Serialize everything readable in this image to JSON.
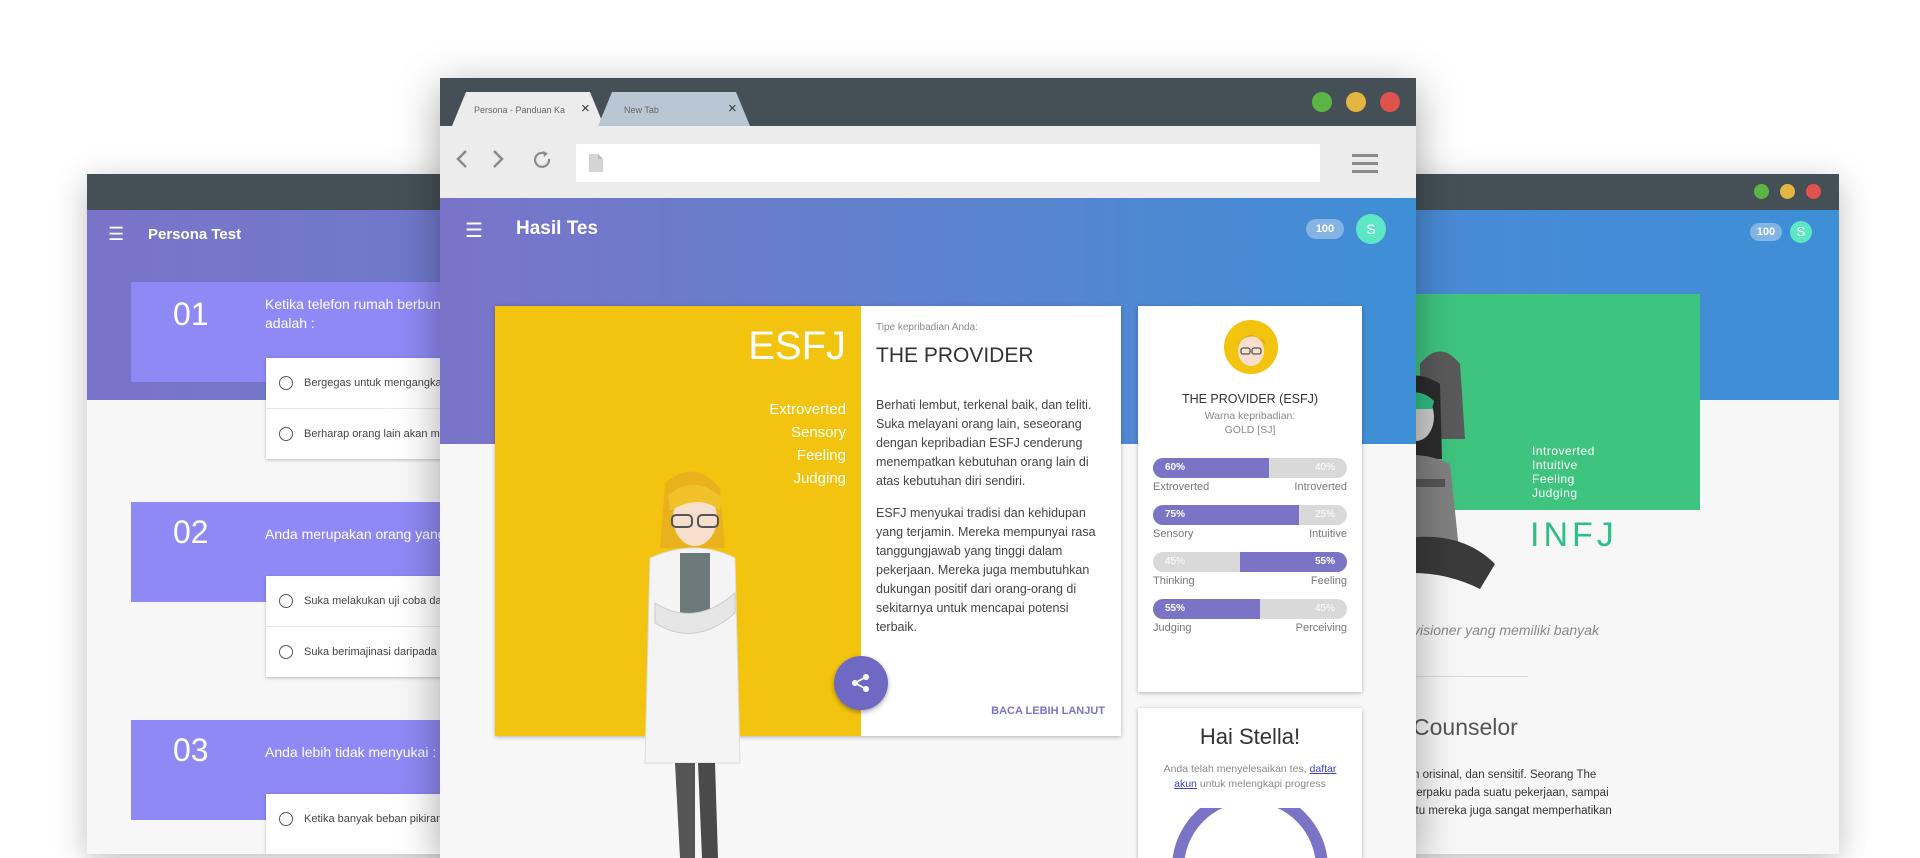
{
  "left_window": {
    "app_title": "Persona Test",
    "questions": [
      {
        "number": "01",
        "text": "Ketika telefon rumah berbunyi",
        "text_line2": "adalah :",
        "options": [
          "Bergegas untuk mengangkat",
          "Berharap orang lain akan men"
        ]
      },
      {
        "number": "02",
        "text": "Anda merupakan orang yang",
        "text_line2": "",
        "options": [
          "Suka melakukan uji coba dari",
          "Suka berimajinasi daripada m"
        ]
      },
      {
        "number": "03",
        "text": "Anda lebih tidak menyukai :",
        "text_line2": "",
        "options": [
          "Ketika banyak beban pikiran"
        ]
      }
    ]
  },
  "right_window": {
    "badge": "100",
    "avatar_initial": "S",
    "traits": [
      "Introverted",
      "Intuitive",
      "Feeling",
      "Judging"
    ],
    "type_code": "INFJ",
    "desc_italic": "visioner yang memiliki banyak",
    "subtitle": "Counselor",
    "body_lines": [
      "n orisinal, dan sensitif. Seorang The",
      "terpaku pada suatu pekerjaan, sampai",
      "itu mereka juga sangat memperhatikan"
    ]
  },
  "browser": {
    "tabs": [
      {
        "label": "Persona - Panduan Ka",
        "active": true
      },
      {
        "label": "New Tab",
        "active": false
      }
    ],
    "address_value": "",
    "window_buttons": {
      "green": "#5ab544",
      "yellow": "#e2b640",
      "red": "#e0534d"
    }
  },
  "app": {
    "title": "Hasil Tes",
    "badge": "100",
    "avatar_initial": "S"
  },
  "result": {
    "type_code": "ESFJ",
    "traits": [
      "Extroverted",
      "Sensory",
      "Feeling",
      "Judging"
    ],
    "caption": "Tipe kepribadian Anda:",
    "name": "THE PROVIDER",
    "para1": "Berhati lembut, terkenal baik, dan teliti. Suka melayani orang lain, seseorang dengan kepribadian ESFJ cenderung menempatkan kebutuhan orang lain di atas kebutuhan diri sendiri.",
    "para2": "ESFJ menyukai tradisi dan kehidupan yang terjamin. Mereka mempunyai rasa tanggungjawab yang tinggi dalam pekerjaan. Mereka juga membutuhkan dukungan positif dari orang-orang di sekitarnya untuk mencapai potensi terbaik.",
    "more_link": "BACA LEBIH LANJUT",
    "accent_color": "#f2c30f"
  },
  "profile": {
    "title": "THE PROVIDER (ESFJ)",
    "color_caption": "Warna kepribadian:",
    "color_value": "GOLD [SJ]",
    "dimensions": [
      {
        "left_pct": "60%",
        "right_pct": "40%",
        "left_label": "Extroverted",
        "right_label": "Introverted",
        "value": 0.6,
        "fill_side": "left"
      },
      {
        "left_pct": "75%",
        "right_pct": "25%",
        "left_label": "Sensory",
        "right_label": "Intuitive",
        "value": 0.75,
        "fill_side": "left"
      },
      {
        "left_pct": "45%",
        "right_pct": "55%",
        "left_label": "Thinking",
        "right_label": "Feeling",
        "value": 0.55,
        "fill_side": "right"
      },
      {
        "left_pct": "55%",
        "right_pct": "45%",
        "left_label": "Judging",
        "right_label": "Perceiving",
        "value": 0.55,
        "fill_side": "left"
      }
    ]
  },
  "greeting": {
    "title": "Hai Stella!",
    "text_before": "Anda telah menyelesaikan tes,",
    "link": "daftar akun",
    "text_after": "untuk melengkapi progress"
  }
}
